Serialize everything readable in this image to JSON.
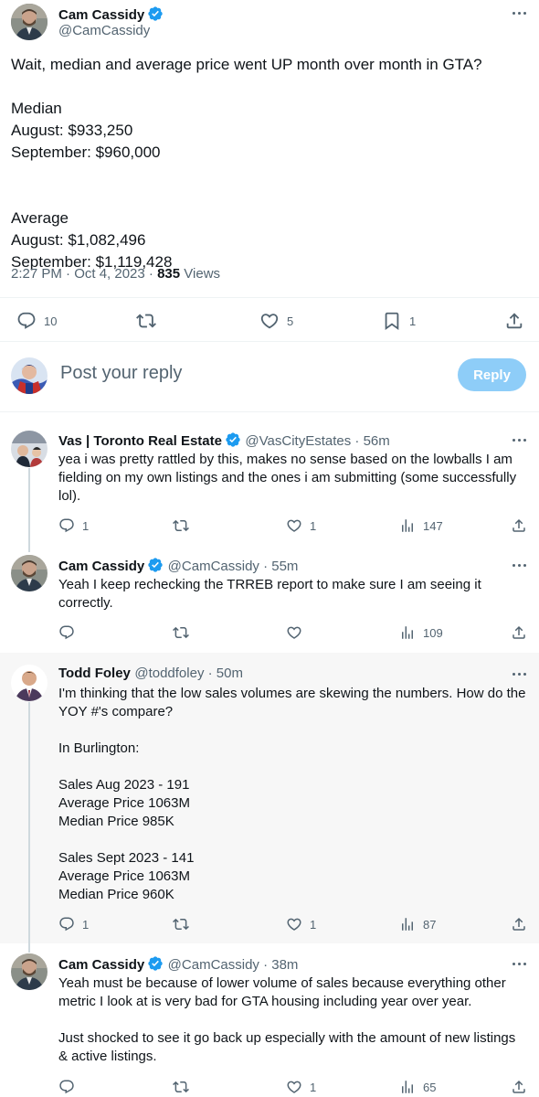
{
  "main_tweet": {
    "author_name": "Cam Cassidy",
    "author_handle": "@CamCassidy",
    "text": "Wait, median and average price went UP month over month in GTA?\n\nMedian\nAugust: $933,250\nSeptember: $960,000\n\n\nAverage\nAugust: $1,082,496\nSeptember: $1,119,428",
    "time": "2:27 PM · Oct 4, 2023 · ",
    "views_count": "835",
    "views_label": "Views",
    "replies": "10",
    "likes": "5",
    "bookmarks": "1"
  },
  "compose": {
    "placeholder": "Post your reply",
    "button": "Reply"
  },
  "replies": [
    {
      "author_name": "Vas | Toronto Real Estate",
      "author_handle": "@VasCityEstates · 56m",
      "text": "yea i was pretty rattled by this, makes no sense based on the lowballs I am fielding on my own listings and the ones i am submitting (some successfully lol).",
      "replies": "1",
      "likes": "1",
      "views": "147"
    },
    {
      "author_name": "Cam Cassidy",
      "author_handle": "@CamCassidy · 55m",
      "text": "Yeah I keep rechecking the TRREB report to make sure I am seeing it correctly.",
      "replies": "",
      "likes": "",
      "views": "109"
    },
    {
      "author_name": "Todd Foley",
      "author_handle": "@toddfoley · 50m",
      "text": "I'm thinking that the low sales volumes are skewing the numbers. How do the YOY #'s compare?\n\nIn Burlington:\n\nSales Aug 2023 - 191\nAverage Price 1063M\nMedian Price 985K\n\nSales Sept 2023 - 141\nAverage Price 1063M\nMedian Price 960K",
      "replies": "1",
      "likes": "1",
      "views": "87"
    },
    {
      "author_name": "Cam Cassidy",
      "author_handle": "@CamCassidy · 38m",
      "text": "Yeah must be because of lower volume of sales because everything other metric I look at is very bad for GTA housing including year over year.\n\nJust shocked to see it go back up especially with the amount of new listings & active listings.",
      "replies": "",
      "likes": "1",
      "views": "65"
    }
  ],
  "icons": {
    "verified": "verified-badge-icon",
    "reply": "reply-icon",
    "retweet": "repost-icon",
    "like": "heart-icon",
    "bookmark": "bookmark-icon",
    "share": "share-icon",
    "views": "views-icon",
    "more": "more-icon"
  },
  "colors": {
    "verified": "#1d9bf0",
    "reply_button": "#8ecdf8",
    "secondary_text": "#536471",
    "highlight_bg": "#f7f7f7"
  }
}
